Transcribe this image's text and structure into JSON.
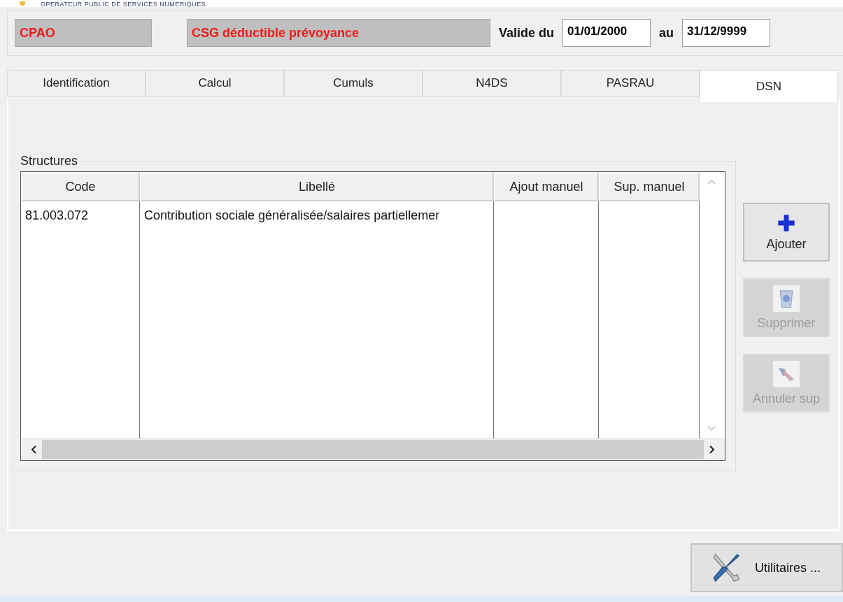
{
  "banner": {
    "subtitle": "OPERATEUR PUBLIC DE SERVICES NUMERIQUES"
  },
  "header": {
    "code": "CPAO",
    "label": "CSG déductible prévoyance",
    "valid_from_label": "Valide du",
    "valid_from": "01/01/2000",
    "valid_to_label": "au",
    "valid_to": "31/12/9999"
  },
  "tabs": [
    {
      "label": "Identification",
      "selected": false
    },
    {
      "label": "Calcul",
      "selected": false
    },
    {
      "label": "Cumuls",
      "selected": false
    },
    {
      "label": "N4DS",
      "selected": false
    },
    {
      "label": "PASRAU",
      "selected": false
    },
    {
      "label": "DSN",
      "selected": true
    }
  ],
  "structures": {
    "title": "Structures",
    "columns": [
      "Code",
      "Libellé",
      "Ajout manuel",
      "Sup. manuel"
    ],
    "rows": [
      {
        "cells": [
          "81.003.072",
          "Contribution sociale généralisée/salaires partiellemer",
          "",
          ""
        ]
      }
    ]
  },
  "actions": [
    {
      "kind": "add",
      "label": "Ajouter",
      "disabled": false
    },
    {
      "kind": "delete",
      "label": "Supprimer",
      "disabled": true
    },
    {
      "kind": "undo",
      "label": "Annuler sup",
      "disabled": true
    }
  ],
  "footer": {
    "button": "Utilitaires ..."
  }
}
